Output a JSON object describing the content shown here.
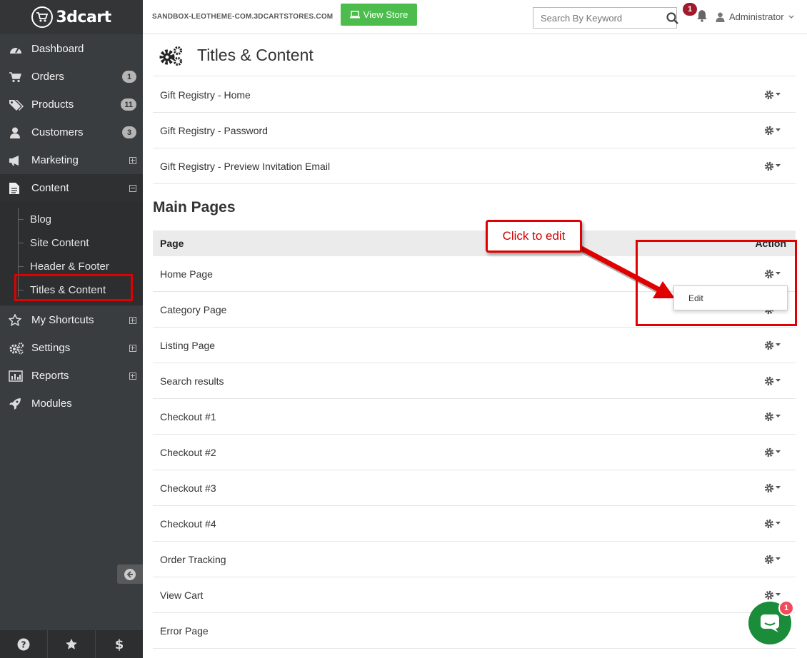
{
  "brand": {
    "logo_text": "3dcart"
  },
  "topbar": {
    "store_url": "SANDBOX-LEOTHEME-COM.3DCARTSTORES.COM",
    "view_store_label": "View Store",
    "search_placeholder": "Search By Keyword",
    "notification_count": "1",
    "user_label": "Administrator"
  },
  "sidebar": {
    "items": [
      {
        "label": "Dashboard",
        "icon": "dashboard-icon"
      },
      {
        "label": "Orders",
        "icon": "cart-icon",
        "badge": "1"
      },
      {
        "label": "Products",
        "icon": "tags-icon",
        "badge": "11"
      },
      {
        "label": "Customers",
        "icon": "user-icon",
        "badge": "3"
      },
      {
        "label": "Marketing",
        "icon": "megaphone-icon"
      },
      {
        "label": "Content",
        "icon": "file-icon"
      },
      {
        "label": "My Shortcuts",
        "icon": "star-icon"
      },
      {
        "label": "Settings",
        "icon": "cogs-icon"
      },
      {
        "label": "Reports",
        "icon": "bar-chart-icon"
      },
      {
        "label": "Modules",
        "icon": "rocket-icon"
      }
    ],
    "content_submenu": [
      "Blog",
      "Site Content",
      "Header & Footer",
      "Titles & Content"
    ],
    "bottom_icons": [
      "help-icon",
      "star-icon",
      "dollar-icon"
    ]
  },
  "page": {
    "title": "Titles & Content",
    "gift_rows": [
      "Gift Registry - Home",
      "Gift Registry - Password",
      "Gift Registry - Preview Invitation Email"
    ],
    "section_title": "Main Pages",
    "table_headers": {
      "page": "Page",
      "action": "Action"
    },
    "main_rows": [
      "Home Page",
      "Category Page",
      "Listing Page",
      "Search results",
      "Checkout #1",
      "Checkout #2",
      "Checkout #3",
      "Checkout #4",
      "Order Tracking",
      "View Cart",
      "Error Page"
    ]
  },
  "dropdown": {
    "edit_label": "Edit"
  },
  "annotation": {
    "callout_text": "Click to edit",
    "color": "#e00000"
  },
  "chat": {
    "badge": "1"
  },
  "colors": {
    "sidebar_bg": "#3a3d40",
    "view_store_green": "#4cbc4c",
    "notif_red": "#a0192c",
    "chat_green": "#1a8c3a"
  }
}
